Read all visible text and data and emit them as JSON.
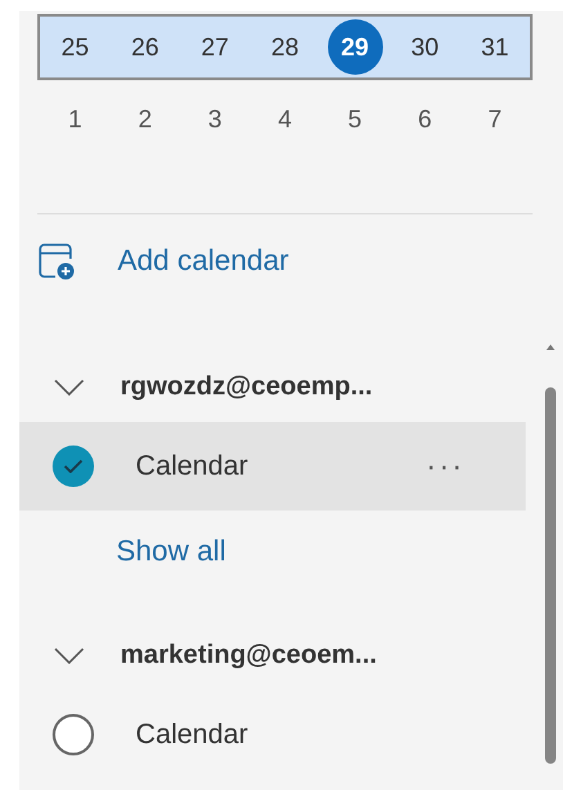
{
  "weeks": [
    {
      "current": true,
      "days": [
        {
          "label": "25",
          "selected": false
        },
        {
          "label": "26",
          "selected": false
        },
        {
          "label": "27",
          "selected": false
        },
        {
          "label": "28",
          "selected": false
        },
        {
          "label": "29",
          "selected": true
        },
        {
          "label": "30",
          "selected": false
        },
        {
          "label": "31",
          "selected": false
        }
      ]
    },
    {
      "current": false,
      "days": [
        {
          "label": "1",
          "selected": false
        },
        {
          "label": "2",
          "selected": false
        },
        {
          "label": "3",
          "selected": false
        },
        {
          "label": "4",
          "selected": false
        },
        {
          "label": "5",
          "selected": false
        },
        {
          "label": "6",
          "selected": false
        },
        {
          "label": "7",
          "selected": false
        }
      ]
    }
  ],
  "add_calendar": {
    "label": "Add calendar"
  },
  "groups": [
    {
      "name": "rgwozdz@ceoemp...",
      "expanded": true,
      "calendars": [
        {
          "name": "Calendar",
          "checked": true,
          "selected": true,
          "more": "···"
        }
      ],
      "show_all": "Show all"
    },
    {
      "name": "marketing@ceoem...",
      "expanded": true,
      "calendars": [
        {
          "name": "Calendar",
          "checked": false,
          "selected": false
        }
      ]
    }
  ]
}
